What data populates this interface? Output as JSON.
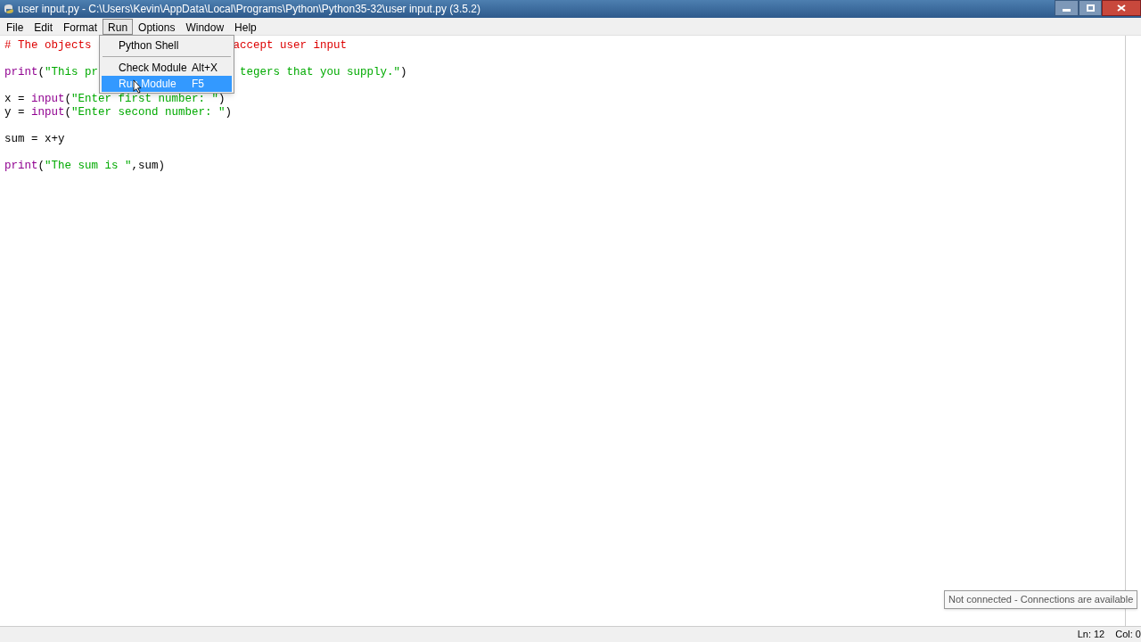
{
  "window": {
    "title": "user input.py - C:\\Users\\Kevin\\AppData\\Local\\Programs\\Python\\Python35-32\\user input.py (3.5.2)"
  },
  "menubar": [
    {
      "label": "File",
      "selected": false
    },
    {
      "label": "Edit",
      "selected": false
    },
    {
      "label": "Format",
      "selected": false
    },
    {
      "label": "Run",
      "selected": true
    },
    {
      "label": "Options",
      "selected": false
    },
    {
      "label": "Window",
      "selected": false
    },
    {
      "label": "Help",
      "selected": false
    }
  ],
  "run_menu": [
    {
      "kind": "item",
      "label": "Python Shell",
      "selected": false
    },
    {
      "kind": "separator"
    },
    {
      "kind": "item",
      "label": "Check Module",
      "shortcut": "Alt+X",
      "selected": false
    },
    {
      "kind": "item",
      "label": "Run Module",
      "shortcut": "F5",
      "selected": true
    }
  ],
  "code_lines": [
    {
      "kind": "code",
      "segments": [
        {
          "tokens": [
            {
              "kind": "comment",
              "text": "# The objects"
            }
          ]
        },
        {
          "tokens": [
            {
              "kind": "comment",
              "text": "accept user input"
            }
          ]
        }
      ]
    },
    {
      "kind": "blank"
    },
    {
      "kind": "code",
      "segments": [
        {
          "tokens": [
            {
              "kind": "builtin",
              "text": "print"
            },
            {
              "kind": "plain",
              "text": "("
            },
            {
              "kind": "string",
              "text": "\"This pr"
            }
          ]
        },
        {
          "tokens": [
            {
              "kind": "string",
              "text": "tegers that you supply.\""
            },
            {
              "kind": "plain",
              "text": ")"
            }
          ]
        }
      ]
    },
    {
      "kind": "blank"
    },
    {
      "kind": "code",
      "segments": [
        {
          "tokens": [
            {
              "kind": "plain",
              "text": "x = "
            },
            {
              "kind": "builtin",
              "text": "input"
            },
            {
              "kind": "plain",
              "text": "("
            },
            {
              "kind": "string",
              "text": "\"Enter first number: \""
            },
            {
              "kind": "plain",
              "text": ")"
            }
          ]
        }
      ]
    },
    {
      "kind": "code",
      "segments": [
        {
          "tokens": [
            {
              "kind": "plain",
              "text": "y = "
            },
            {
              "kind": "builtin",
              "text": "input"
            },
            {
              "kind": "plain",
              "text": "("
            },
            {
              "kind": "string",
              "text": "\"Enter second number: \""
            },
            {
              "kind": "plain",
              "text": ")"
            }
          ]
        }
      ]
    },
    {
      "kind": "blank"
    },
    {
      "kind": "code",
      "segments": [
        {
          "tokens": [
            {
              "kind": "plain",
              "text": "sum = x+y"
            }
          ]
        }
      ]
    },
    {
      "kind": "blank"
    },
    {
      "kind": "code",
      "segments": [
        {
          "tokens": [
            {
              "kind": "builtin",
              "text": "print"
            },
            {
              "kind": "plain",
              "text": "("
            },
            {
              "kind": "string",
              "text": "\"The sum is \""
            },
            {
              "kind": "plain",
              "text": ",sum)"
            }
          ]
        }
      ]
    }
  ],
  "tooltip": "Not connected - Connections are available",
  "status_bar": {
    "line": "Ln: 12",
    "column": "Col: 0"
  }
}
